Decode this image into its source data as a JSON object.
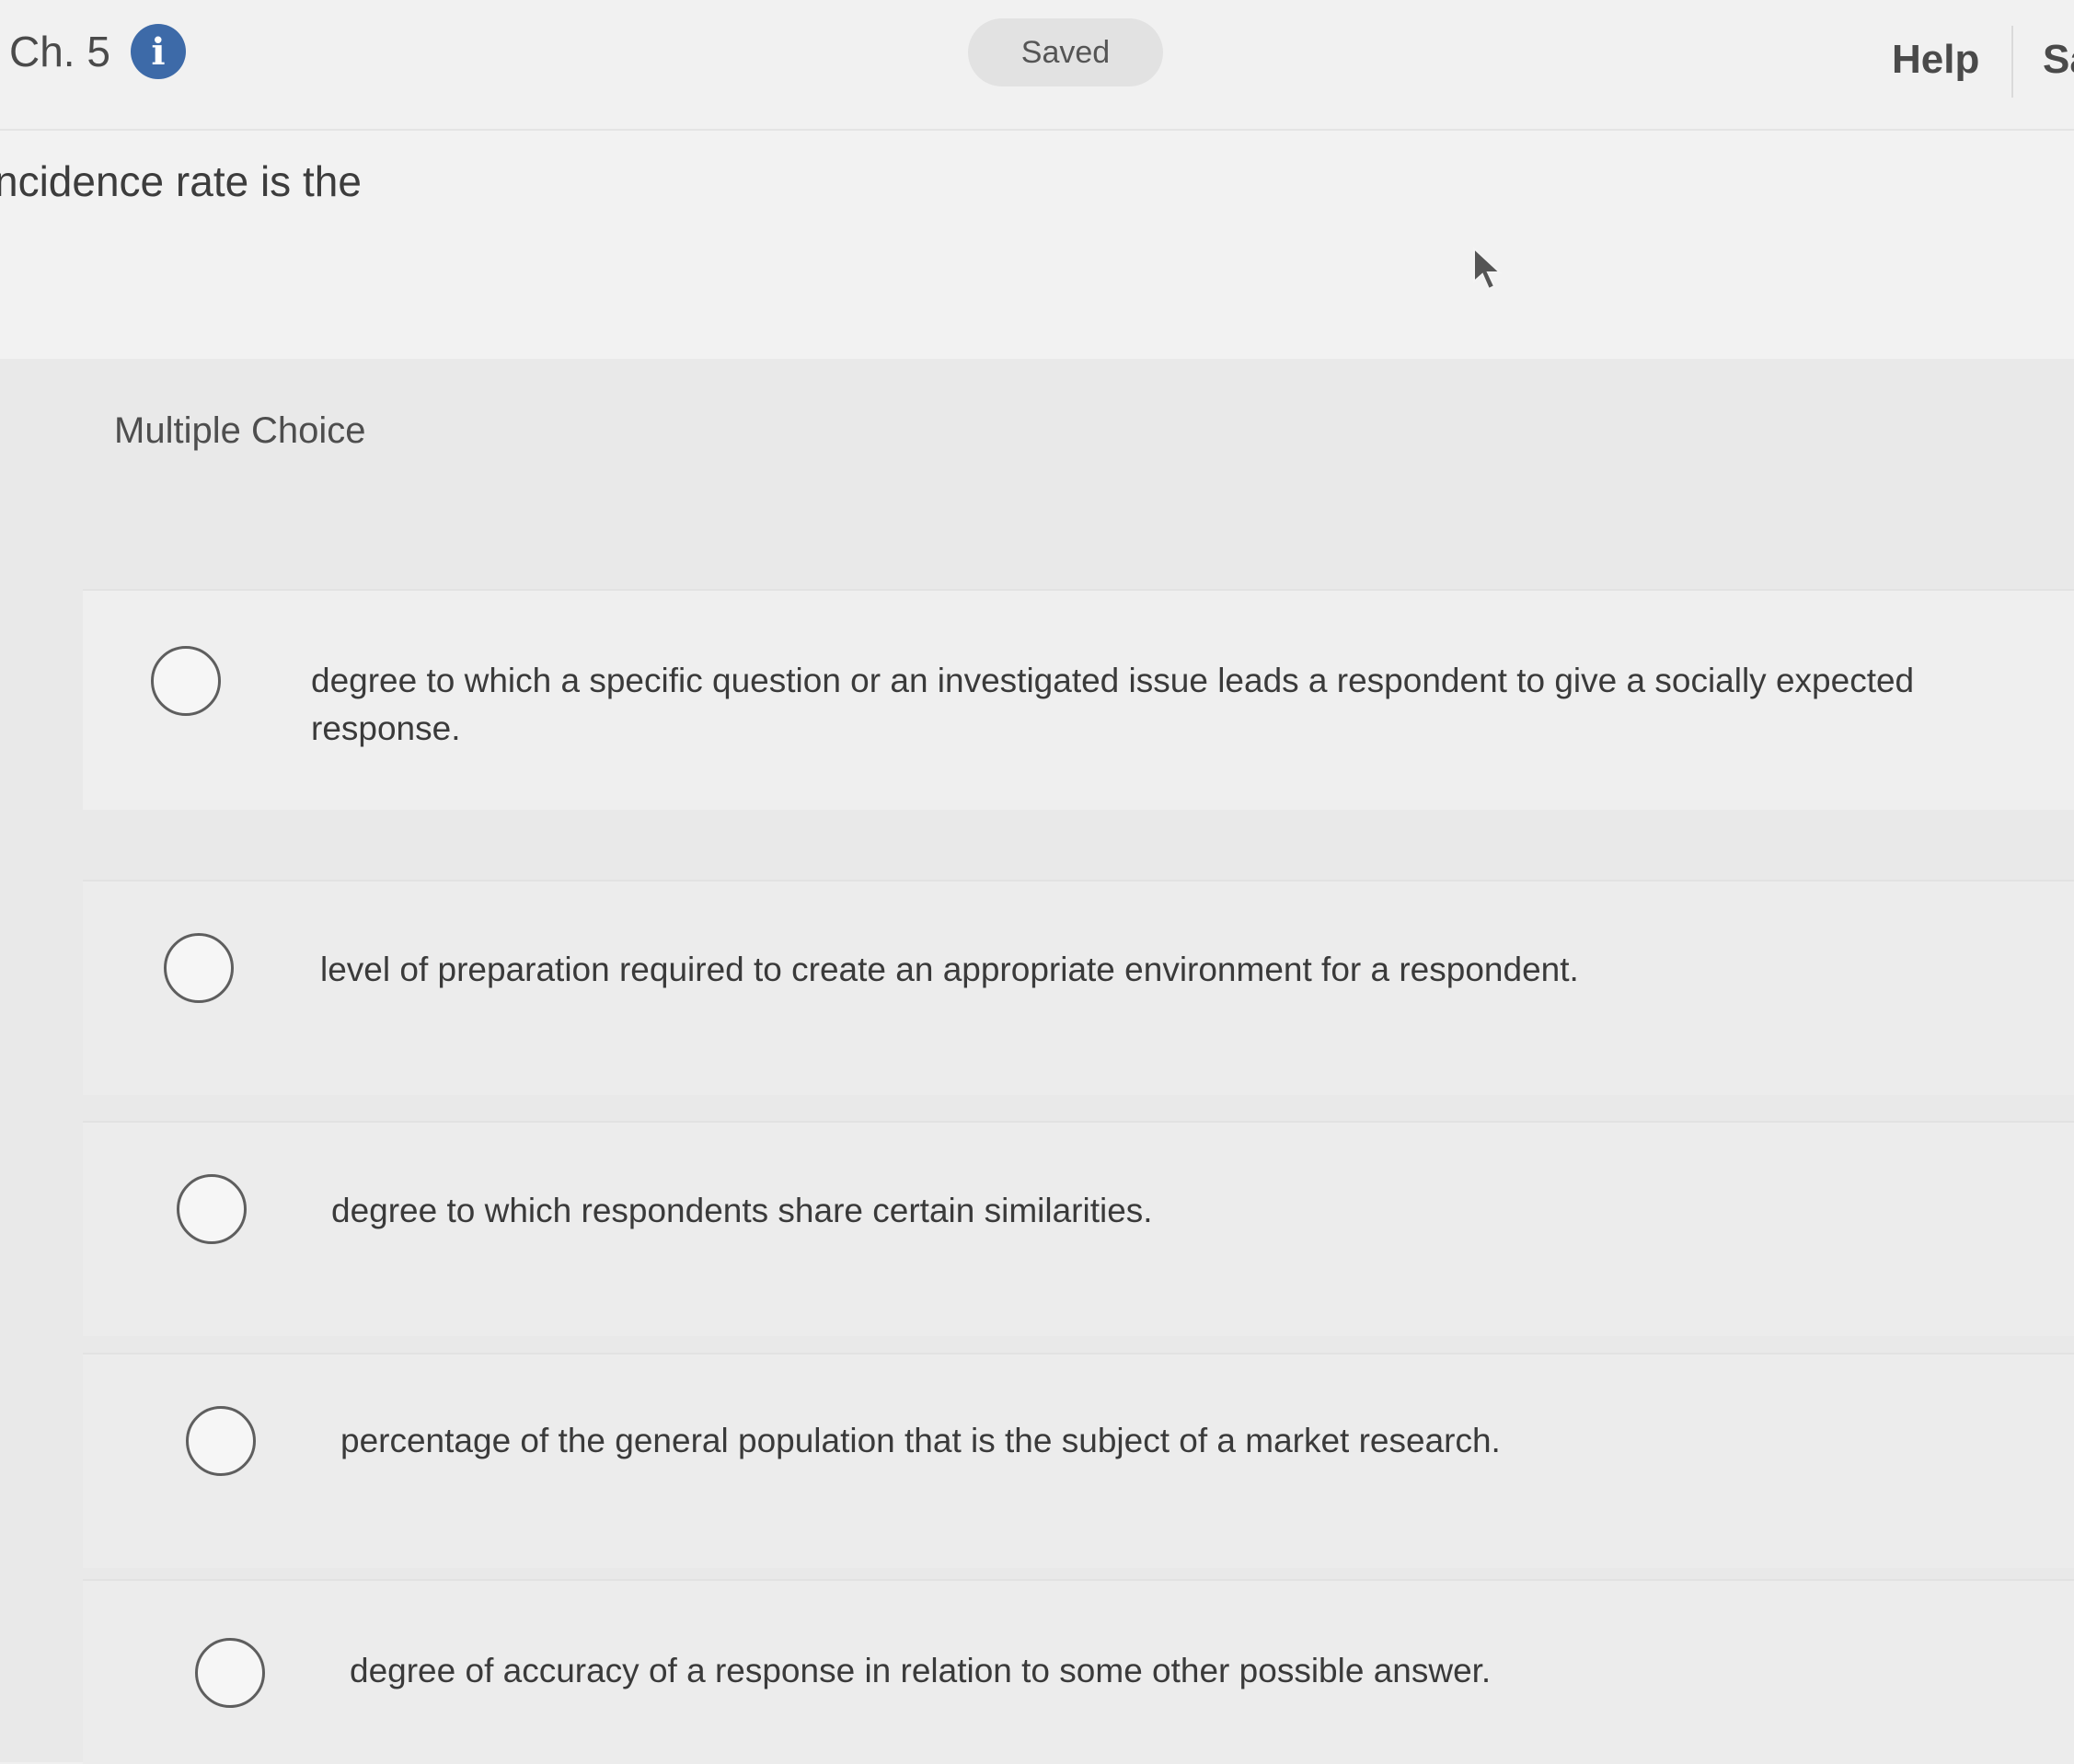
{
  "header": {
    "chapter_label": "Ch. 5",
    "info_icon": "info-icon",
    "status_label": "Saved",
    "help_label": "Help",
    "save_exit_label": "Sa"
  },
  "question": {
    "text": "ncidence rate is the"
  },
  "answers": {
    "type_label": "Multiple Choice",
    "options": [
      {
        "text": "degree to which a specific question or an investigated issue leads a respondent to give a socially expected response."
      },
      {
        "text": "level of preparation required to create an appropriate environment for a respondent."
      },
      {
        "text": "degree to which respondents share certain similarities."
      },
      {
        "text": "percentage of the general population that is the subject of a market research."
      },
      {
        "text": "degree of accuracy of a response in relation to some other possible answer."
      }
    ]
  },
  "colors": {
    "info_icon_bg": "#3d6aa8",
    "background": "#f0f0f0",
    "text": "#3a3a3a"
  }
}
